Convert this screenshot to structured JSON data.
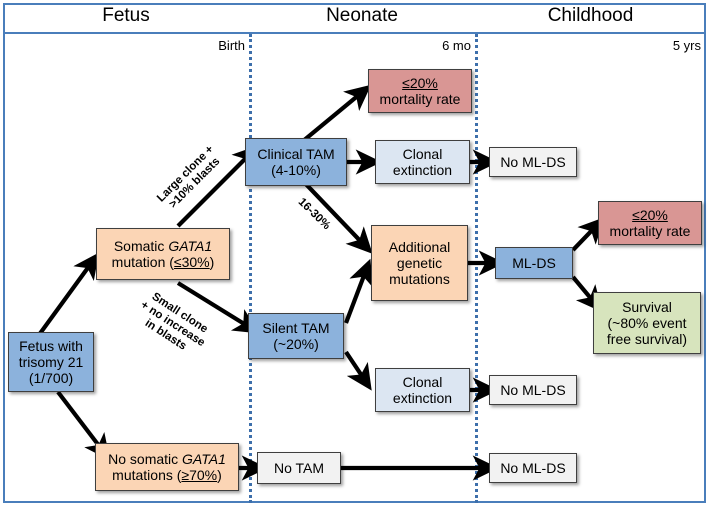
{
  "figure": {
    "type": "flowchart",
    "subject": "Natural history of GATA1-mutant clones in Down syndrome: from fetus with trisomy 21 through TAM to ML-DS",
    "accent_border_color": "#4a7ebb",
    "divider_color": "#3d6fab"
  },
  "timeline": {
    "eras": [
      {
        "title": "Fetus",
        "boundary_label": "Birth"
      },
      {
        "title": "Neonate",
        "boundary_label": "6 mo"
      },
      {
        "title": "Childhood",
        "boundary_label": "5 yrs"
      }
    ]
  },
  "nodes": {
    "fetus_trisomy": {
      "line1": "Fetus with",
      "line2": "trisomy 21",
      "line3": "(1/700)",
      "color": "#8cb2dc"
    },
    "somatic_gata1": {
      "line1_pre": "Somatic ",
      "line1_em": "GATA1",
      "line2_pre": "mutation (",
      "line2_u": "≤30%",
      "line2_post": ")",
      "color": "#fbd5b5"
    },
    "no_somatic_gata1": {
      "line1_pre": "No somatic ",
      "line1_em": "GATA1",
      "line2_pre": "mutations (",
      "line2_u": "≥70%",
      "line2_post": ")",
      "color": "#fbd5b5"
    },
    "clinical_tam": {
      "line1": "Clinical  TAM",
      "line2": "(4-10%)",
      "color": "#8cb2dc"
    },
    "silent_tam": {
      "line1": "Silent TAM",
      "line2": "(~20%)",
      "color": "#8cb2dc"
    },
    "no_tam": {
      "line1": "No TAM",
      "color": "#f2f2f2"
    },
    "mortality_top": {
      "line1_u": "≤20%",
      "line2": "mortality rate",
      "color": "#d99694"
    },
    "mortality_right": {
      "line1_u": "≤20%",
      "line2": "mortality rate",
      "color": "#d99694"
    },
    "clonal_extinction_top": {
      "line1": "Clonal",
      "line2": "extinction",
      "color": "#dce6f2"
    },
    "clonal_extinction_bottom": {
      "line1": "Clonal",
      "line2": "extinction",
      "color": "#dce6f2"
    },
    "additional_mutations": {
      "line1": "Additional",
      "line2": "genetic",
      "line3": "mutations",
      "color": "#fbd5b5"
    },
    "ml_ds": {
      "line1": "ML-DS",
      "color": "#8cb2dc"
    },
    "survival": {
      "line1": "Survival",
      "line2": "(~80% event",
      "line3": "free survival)",
      "color": "#d7e4bd"
    },
    "no_mlds_top": {
      "line1": "No ML-DS",
      "color": "#f2f2f2"
    },
    "no_mlds_mid": {
      "line1": "No ML-DS",
      "color": "#f2f2f2"
    },
    "no_mlds_bottom": {
      "line1": "No ML-DS",
      "color": "#f2f2f2"
    }
  },
  "edge_labels": {
    "large_clone": {
      "line1": "Large clone +",
      "line2": ">10% blasts"
    },
    "small_clone": {
      "line1": "Small clone",
      "line2": "+ no increase",
      "line3": "in blasts"
    },
    "progression_rate": {
      "line1": "16-30%"
    }
  }
}
